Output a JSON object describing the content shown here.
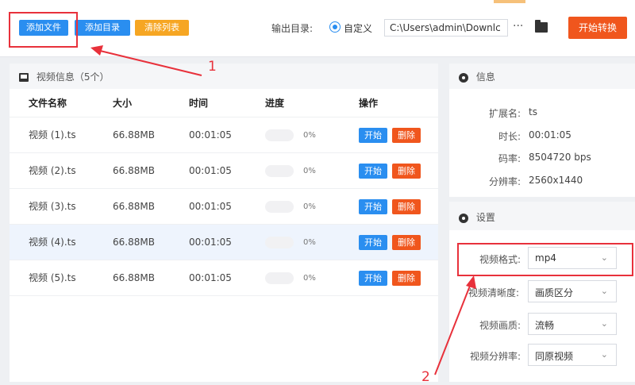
{
  "toolbar": {
    "add_file": "添加文件",
    "add_dir": "添加目录",
    "clear_list": "清除列表",
    "output_dir_label": "输出目录:",
    "custom_label": "自定义",
    "output_path": "C:\\Users\\admin\\Downlc",
    "more": "···",
    "start_convert": "开始转换"
  },
  "annotations": {
    "one": "1",
    "two": "2"
  },
  "video_list": {
    "title": "视频信息（5个）",
    "columns": [
      "文件名称",
      "大小",
      "时间",
      "进度",
      "操作"
    ],
    "rows": [
      {
        "name": "视频 (1).ts",
        "size": "66.88MB",
        "time": "00:01:05",
        "progress": "0%",
        "start": "开始",
        "delete": "删除"
      },
      {
        "name": "视频 (2).ts",
        "size": "66.88MB",
        "time": "00:01:05",
        "progress": "0%",
        "start": "开始",
        "delete": "删除"
      },
      {
        "name": "视频 (3).ts",
        "size": "66.88MB",
        "time": "00:01:05",
        "progress": "0%",
        "start": "开始",
        "delete": "删除"
      },
      {
        "name": "视频 (4).ts",
        "size": "66.88MB",
        "time": "00:01:05",
        "progress": "0%",
        "start": "开始",
        "delete": "删除"
      },
      {
        "name": "视频 (5).ts",
        "size": "66.88MB",
        "time": "00:01:05",
        "progress": "0%",
        "start": "开始",
        "delete": "删除"
      }
    ]
  },
  "info": {
    "title": "信息",
    "ext_label": "扩展名:",
    "ext": "ts",
    "duration_label": "时长:",
    "duration": "00:01:05",
    "bitrate_label": "码率:",
    "bitrate": "8504720 bps",
    "resolution_label": "分辨率:",
    "resolution": "2560x1440"
  },
  "settings": {
    "title": "设置",
    "format_label": "视频格式:",
    "format": "mp4",
    "clarity_label": "视频清晰度:",
    "clarity": "画质区分",
    "quality_label": "视频画质:",
    "quality": "流畅",
    "res_label": "视频分辨率:",
    "res": "同原视频"
  },
  "colors": {
    "accent_blue": "#2a8ef0",
    "accent_orange": "#f6a623",
    "accent_red": "#f0561d",
    "annotation_red": "#e8313b"
  }
}
